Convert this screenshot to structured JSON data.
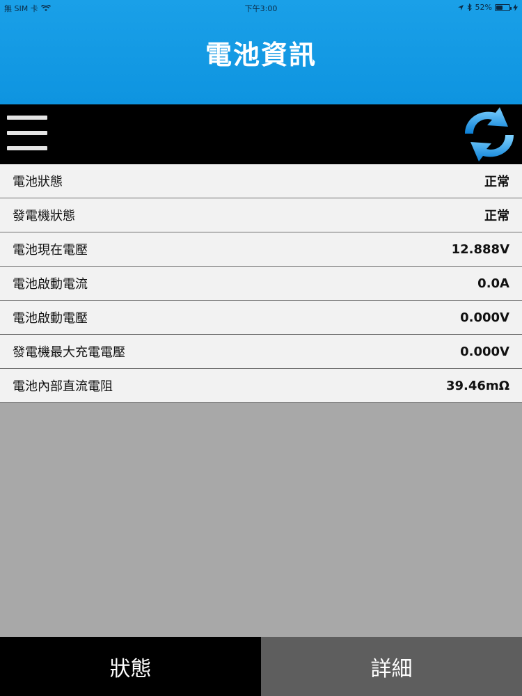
{
  "status_bar": {
    "carrier": "無 SIM 卡",
    "time": "下午3:00",
    "battery_percent": "52%",
    "battery_level": 0.52
  },
  "header": {
    "title": "電池資訊"
  },
  "toolbar": {
    "menu_icon": "hamburger-menu-icon",
    "refresh_icon": "refresh-icon"
  },
  "battery_info": [
    {
      "label": "電池狀態",
      "value": "正常"
    },
    {
      "label": "發電機狀態",
      "value": "正常"
    },
    {
      "label": "電池現在電壓",
      "value": "12.888V"
    },
    {
      "label": "電池啟動電流",
      "value": "0.0A"
    },
    {
      "label": "電池啟動電壓",
      "value": "0.000V"
    },
    {
      "label": "發電機最大充電電壓",
      "value": "0.000V"
    },
    {
      "label": "電池內部直流電阻",
      "value": "39.46mΩ"
    }
  ],
  "tabs": [
    {
      "label": "狀態",
      "selected": true
    },
    {
      "label": "詳細",
      "selected": false
    }
  ],
  "colors": {
    "header_blue": "#1aa0e8",
    "toolbar_black": "#000000",
    "active_tab": "#000000",
    "inactive_tab": "#5e5e5e",
    "background_gray": "#a8a8a8"
  }
}
